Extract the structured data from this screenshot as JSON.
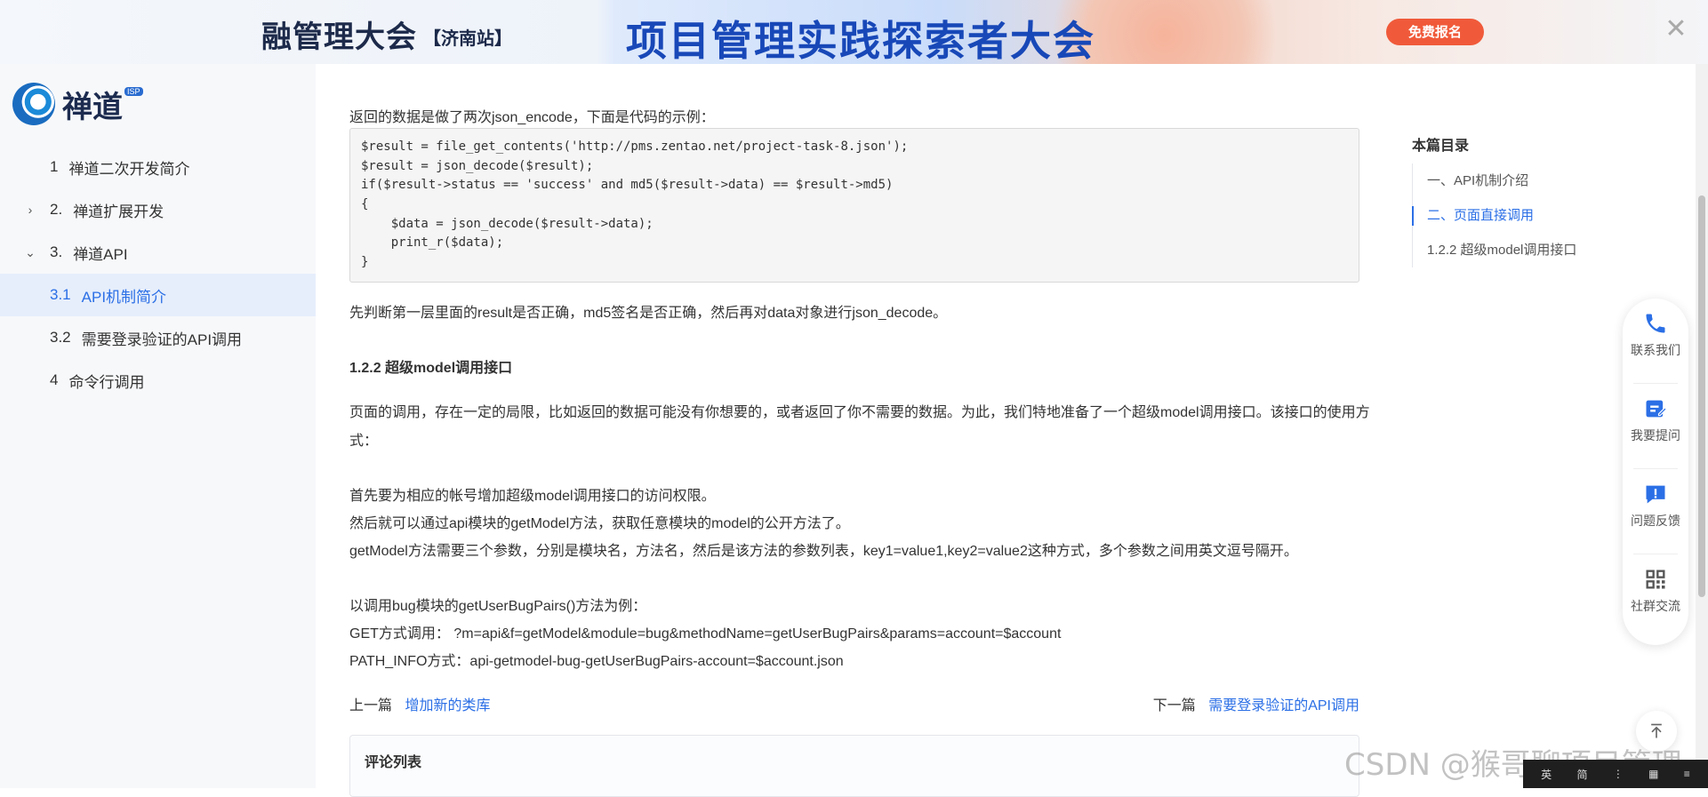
{
  "banner": {
    "left_text": "融管理大会",
    "station": "【济南站】",
    "center_text": "项目管理实践探索者大会",
    "cta": "免费报名",
    "close": "✕"
  },
  "logo": {
    "text": "禅道",
    "sup": "ISP"
  },
  "sidebar": {
    "items": [
      {
        "chev": "",
        "num": "1",
        "label": "禅道二次开发简介"
      },
      {
        "chev": "›",
        "num": "2.",
        "label": "禅道扩展开发"
      },
      {
        "chev": "⌄",
        "num": "3.",
        "label": "禅道API"
      },
      {
        "chev": "",
        "num": "3.1",
        "label": "API机制简介"
      },
      {
        "chev": "",
        "num": "3.2",
        "label": "需要登录验证的API调用"
      },
      {
        "chev": "",
        "num": "4",
        "label": "命令行调用"
      }
    ]
  },
  "content": {
    "intro": "返回的数据是做了两次json_encode，下面是代码的示例：",
    "code": [
      "$result = file_get_contents('http://pms.zentao.net/project-task-8.json');",
      "$result = json_decode($result);",
      "if($result->status == 'success' and md5($result->data) == $result->md5)",
      "{",
      "    $data = json_decode($result->data);",
      "    print_r($data);",
      "}"
    ],
    "after_code": "先判断第一层里面的result是否正确，md5签名是否正确，然后再对data对象进行json_decode。",
    "heading": "1.2.2 超级model调用接口",
    "para1_line1": "页面的调用，存在一定的局限，比如返回的数据可能没有你想要的，或者返回了你不需要的数据。为此，我们特地准备了一个超级model调用接口。该接口的使用方",
    "para1_line2": "式：",
    "step1": "首先要为相应的帐号增加超级model调用接口的访问权限。",
    "step2": "然后就可以通过api模块的getModel方法，获取任意模块的model的公开方法了。",
    "step3": "getModel方法需要三个参数，分别是模块名，方法名，然后是该方法的参数列表，key1=value1,key2=value2这种方式，多个参数之间用英文逗号隔开。",
    "example_title": "以调用bug模块的getUserBugPairs()方法为例：",
    "example_get": "GET方式调用： ?m=api&f=getModel&module=bug&methodName=getUserBugPairs&params=account=$account",
    "example_path": "PATH_INFO方式：api-getmodel-bug-getUserBugPairs-account=$account.json",
    "prev_label": "上一篇",
    "prev_link": "增加新的类库",
    "next_label": "下一篇",
    "next_link": "需要登录验证的API调用",
    "comments_title": "评论列表"
  },
  "toc": {
    "title": "本篇目录",
    "items": [
      {
        "label": "一、API机制介绍"
      },
      {
        "label": "二、页面直接调用"
      },
      {
        "label": "1.2.2 超级model调用接口"
      }
    ]
  },
  "float_panel": {
    "items": [
      {
        "icon": "phone-icon",
        "label": "联系我们"
      },
      {
        "icon": "edit-icon",
        "label": "我要提问"
      },
      {
        "icon": "feedback-icon",
        "label": "问题反馈"
      },
      {
        "icon": "qrcode-icon",
        "label": "社群交流"
      }
    ]
  },
  "watermark": "CSDN @猴哥聊项目管理",
  "taskbar": {
    "ime": "英",
    "ime2": "简"
  },
  "colors": {
    "accent": "#2b6fe6",
    "banner_cta": "#f05a3a",
    "sidebar_bg": "#f7f8fa",
    "active_bg": "#e6eefb"
  }
}
